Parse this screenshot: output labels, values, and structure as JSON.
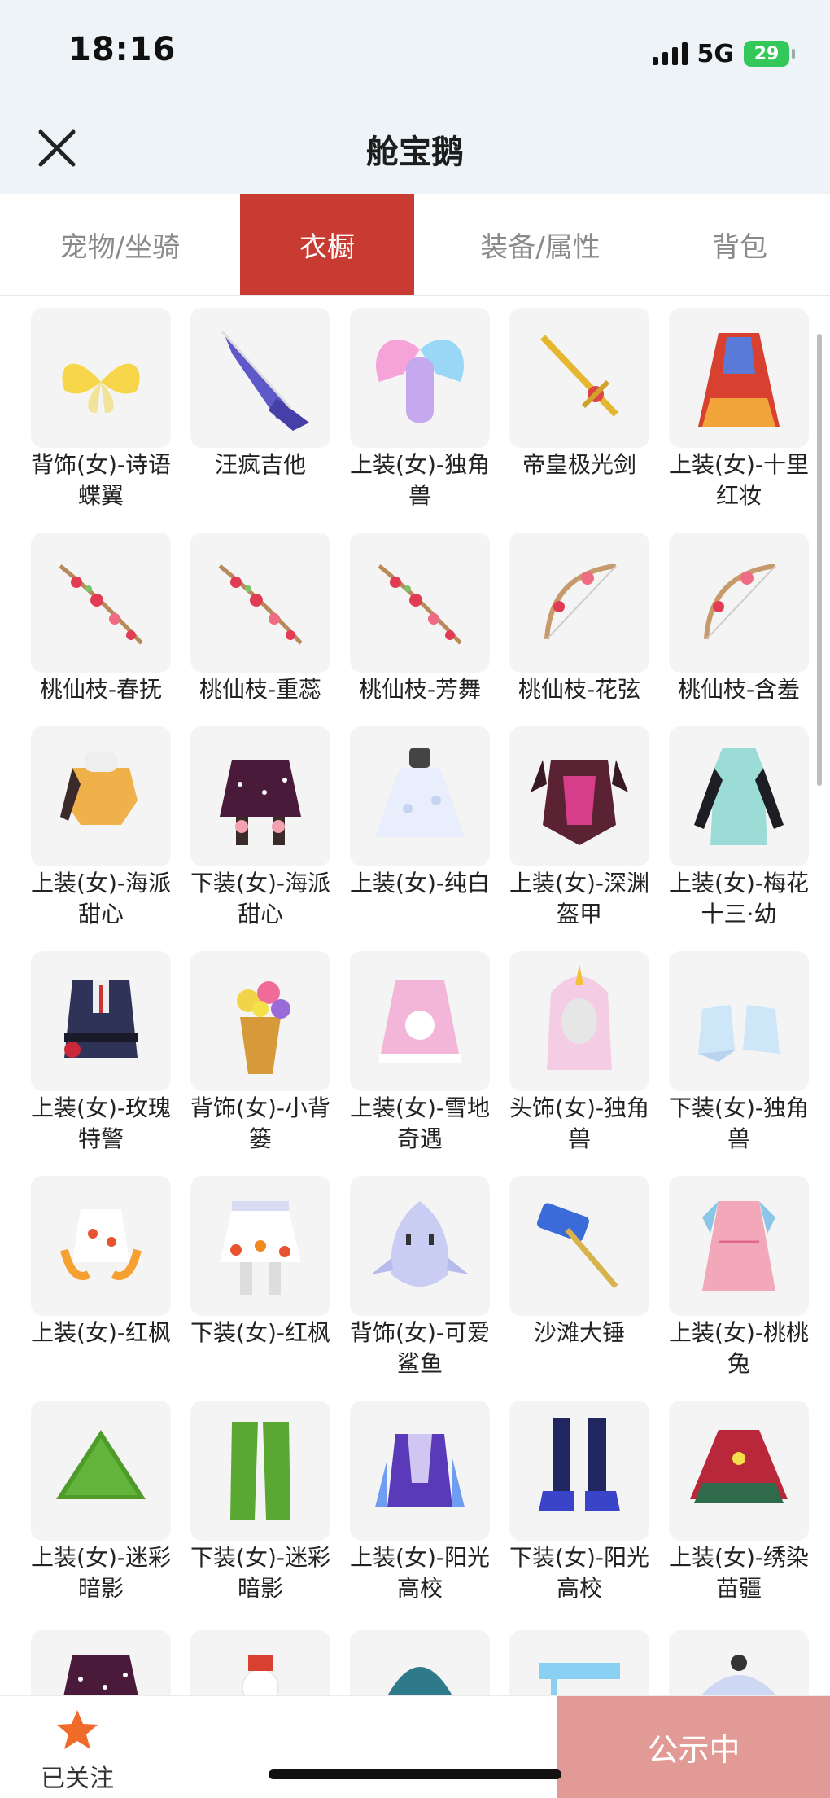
{
  "status": {
    "time": "18:16",
    "network": "5G",
    "battery": "29"
  },
  "header": {
    "title": "舱宝鹅"
  },
  "tabs": [
    {
      "label": "宠物/坐骑",
      "active": false
    },
    {
      "label": "衣橱",
      "active": true
    },
    {
      "label": "装备/属性",
      "active": false
    },
    {
      "label": "背包",
      "active": false
    }
  ],
  "items": [
    {
      "label": "背饰(女)-诗语蝶翼",
      "icon": "butterfly-wings-icon"
    },
    {
      "label": "汪疯吉他",
      "icon": "guitar-icon"
    },
    {
      "label": "上装(女)-独角兽",
      "icon": "unicorn-top-icon"
    },
    {
      "label": "帝皇极光剑",
      "icon": "sword-icon"
    },
    {
      "label": "上装(女)-十里红妆",
      "icon": "red-dress-icon"
    },
    {
      "label": "桃仙枝-春抚",
      "icon": "peach-branch-icon"
    },
    {
      "label": "桃仙枝-重蕊",
      "icon": "peach-branch-icon"
    },
    {
      "label": "桃仙枝-芳舞",
      "icon": "peach-branch-icon"
    },
    {
      "label": "桃仙枝-花弦",
      "icon": "peach-bow-icon"
    },
    {
      "label": "桃仙枝-含羞",
      "icon": "peach-bow-icon"
    },
    {
      "label": "上装(女)-海派甜心",
      "icon": "top-icon"
    },
    {
      "label": "下装(女)-海派甜心",
      "icon": "skirt-icon"
    },
    {
      "label": "上装(女)-纯白",
      "icon": "white-dress-icon"
    },
    {
      "label": "上装(女)-深渊盔甲",
      "icon": "armor-icon"
    },
    {
      "label": "上装(女)-梅花十三·幼",
      "icon": "qipao-icon"
    },
    {
      "label": "上装(女)-玫瑰特警",
      "icon": "uniform-icon"
    },
    {
      "label": "背饰(女)-小背篓",
      "icon": "flower-basket-icon"
    },
    {
      "label": "上装(女)-雪地奇遇",
      "icon": "pink-coat-icon"
    },
    {
      "label": "头饰(女)-独角兽",
      "icon": "unicorn-hood-icon"
    },
    {
      "label": "下装(女)-独角兽",
      "icon": "boots-icon"
    },
    {
      "label": "上装(女)-红枫",
      "icon": "maple-top-icon"
    },
    {
      "label": "下装(女)-红枫",
      "icon": "maple-skirt-icon"
    },
    {
      "label": "背饰(女)-可爱鲨鱼",
      "icon": "shark-icon"
    },
    {
      "label": "沙滩大锤",
      "icon": "hammer-icon"
    },
    {
      "label": "上装(女)-桃桃兔",
      "icon": "pink-dress-icon"
    },
    {
      "label": "上装(女)-迷彩暗影",
      "icon": "ghillie-top-icon"
    },
    {
      "label": "下装(女)-迷彩暗影",
      "icon": "ghillie-pants-icon"
    },
    {
      "label": "上装(女)-阳光高校",
      "icon": "school-jacket-icon"
    },
    {
      "label": "下装(女)-阳光高校",
      "icon": "school-pants-icon"
    },
    {
      "label": "上装(女)-绣染苗疆",
      "icon": "miao-top-icon"
    }
  ],
  "partial_items": [
    {
      "icon": "skirt-icon"
    },
    {
      "icon": "snowman-icon"
    },
    {
      "icon": "hair-icon"
    },
    {
      "icon": "stall-icon"
    },
    {
      "icon": "umbrella-icon"
    }
  ],
  "bottom": {
    "follow_label": "已关注",
    "public_label": "公示中"
  }
}
